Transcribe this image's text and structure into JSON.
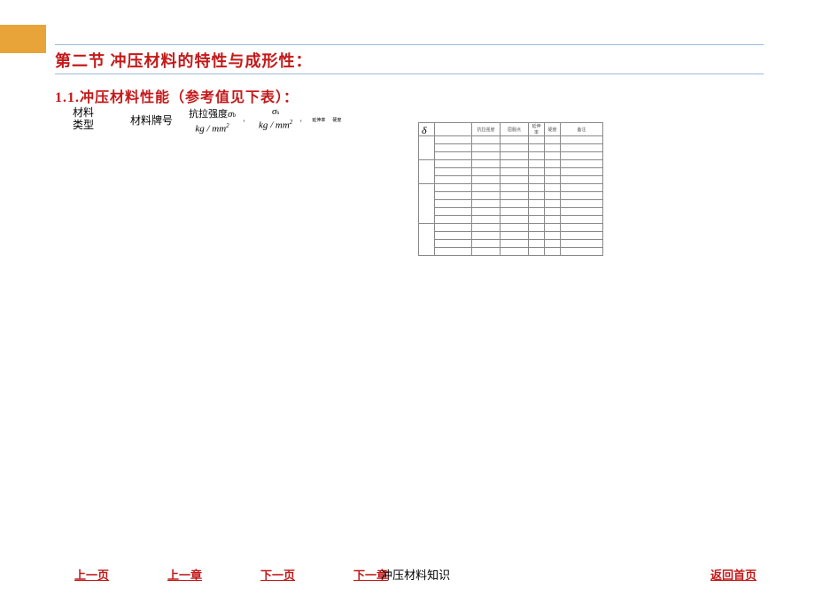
{
  "section_title": "第二节   冲压材料的特性与成形性：",
  "subtitle": "1.1.冲压材料性能（参考值见下表）：",
  "headers": {
    "material_type": "材料\n类型",
    "material_grade": "材料牌号",
    "tensile_strength": "抗拉强度",
    "sigma_b": "σ",
    "sigma_b_sub": "b",
    "sigma_s": "σ",
    "sigma_s_sub": "s",
    "unit": "kg / mm",
    "unit_sup": "2",
    "delta": "δ"
  },
  "table_headers": {
    "h1": "",
    "h2": "",
    "h3": "抗拉强度",
    "h4": "屈服点",
    "h5": "延伸率",
    "h6": "硬度",
    "h7": "备注"
  },
  "nav": {
    "prev_page": "上一页",
    "prev_chapter": "上一章",
    "next_page": "下一页",
    "next_chapter": "下一章",
    "footer_title": "冲压材料知识",
    "home": "返回首页"
  }
}
